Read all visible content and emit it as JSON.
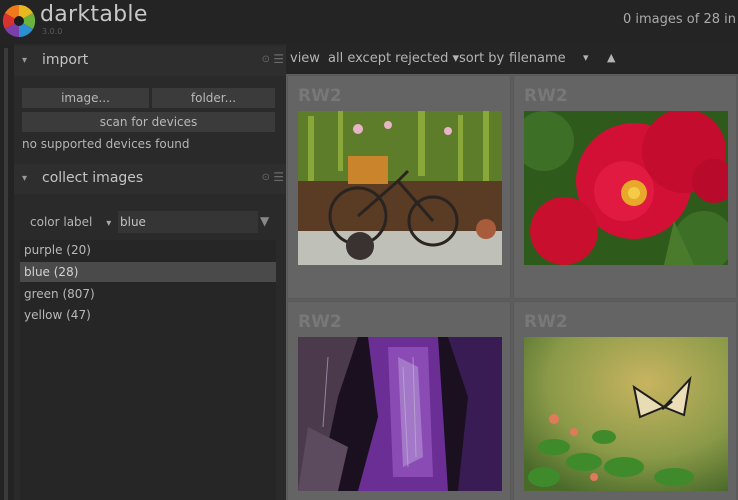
{
  "app": {
    "name": "darktable",
    "version": "3.0.0",
    "image_count": "0 images of 28 in"
  },
  "import": {
    "title": "import",
    "buttons": [
      "image...",
      "folder...",
      "scan for devices"
    ],
    "status": "no supported devices found"
  },
  "collect": {
    "title": "collect images",
    "property": "color label",
    "property_arrow": "▾",
    "entry_value": "blue",
    "entry_arrow": "▼",
    "items": [
      {
        "label": "purple (20)",
        "selected": false
      },
      {
        "label": "blue (28)",
        "selected": true
      },
      {
        "label": "green (807)",
        "selected": false
      },
      {
        "label": "yellow (47)",
        "selected": false
      }
    ]
  },
  "toolbar": {
    "view_label": "view",
    "view_value": "all except rejected ▾",
    "sort_label": "sort by",
    "sort_value": "filename",
    "sort_arrow": "▾",
    "sort_order": "▲"
  },
  "thumbnails": [
    {
      "ext": "RW2",
      "subject": "garden-bicycle"
    },
    {
      "ext": "RW2",
      "subject": "red-rose"
    },
    {
      "ext": "RW2",
      "subject": "purple-texture"
    },
    {
      "ext": "RW2",
      "subject": "butterfly"
    }
  ],
  "icons": {
    "module_expand": "▾",
    "reset": "⊙",
    "presets": "☰"
  }
}
